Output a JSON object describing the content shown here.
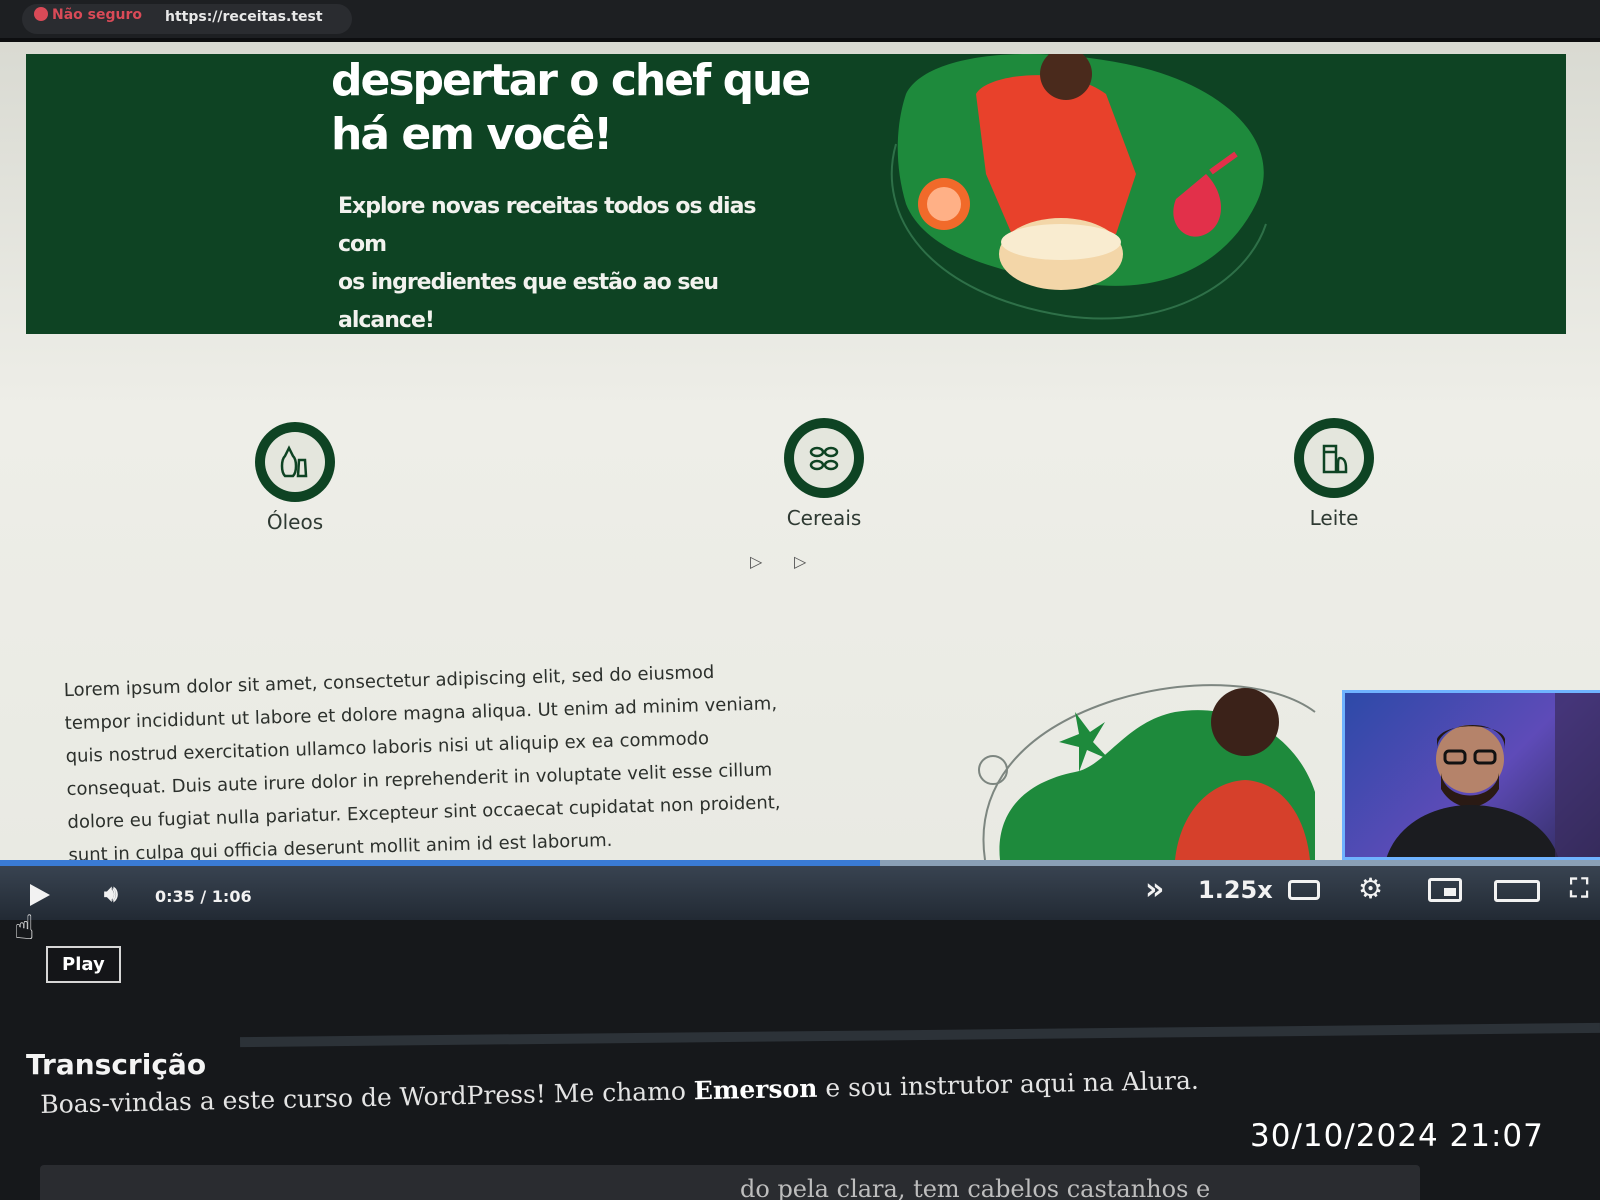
{
  "browser": {
    "security_label": "Não seguro",
    "url": "https://receitas.test"
  },
  "hero": {
    "title_line1": "despertar o chef que",
    "title_line2": "há em você!",
    "subtitle_line1": "Explore novas receitas todos os dias com",
    "subtitle_line2": "os ingredientes que estão ao seu alcance!"
  },
  "categories": [
    {
      "label": "Óleos",
      "icon": "oil-bottles-icon"
    },
    {
      "label": "Cereais",
      "icon": "cereal-grains-icon"
    },
    {
      "label": "Leite",
      "icon": "milk-carton-icon"
    }
  ],
  "content": {
    "lorem": "Lorem ipsum dolor sit amet, consectetur adipiscing elit, sed do eiusmod tempor incididunt ut labore et dolore magna aliqua. Ut enim ad minim veniam, quis nostrud exercitation ullamco laboris nisi ut aliquip ex ea commodo consequat. Duis aute irure dolor in reprehenderit in voluptate velit esse cillum dolore eu fugiat nulla pariatur. Excepteur sint occaecat cupidatat non proident, sunt in culpa qui officia deserunt mollit anim id est laborum."
  },
  "player": {
    "current_time": "0:35",
    "separator": "/",
    "duration": "1:06",
    "progress": 0.55,
    "speed": "1.25x",
    "tooltip": "Play",
    "colors": {
      "progress": "#3a7bd5",
      "track": "#8aa0b6"
    }
  },
  "transcript": {
    "heading": "Transcrição",
    "text_before": "Boas-vindas a este curso de WordPress! Me chamo ",
    "name": "Emerson",
    "text_after": " e sou instrutor aqui na Alura.",
    "next_line_fragment": "do pela clara, tem cabelos castanhos e"
  },
  "overlay": {
    "timestamp": "30/10/2024  21:07"
  },
  "colors": {
    "brand_green": "#0e4323",
    "accent_red": "#e8412b"
  }
}
